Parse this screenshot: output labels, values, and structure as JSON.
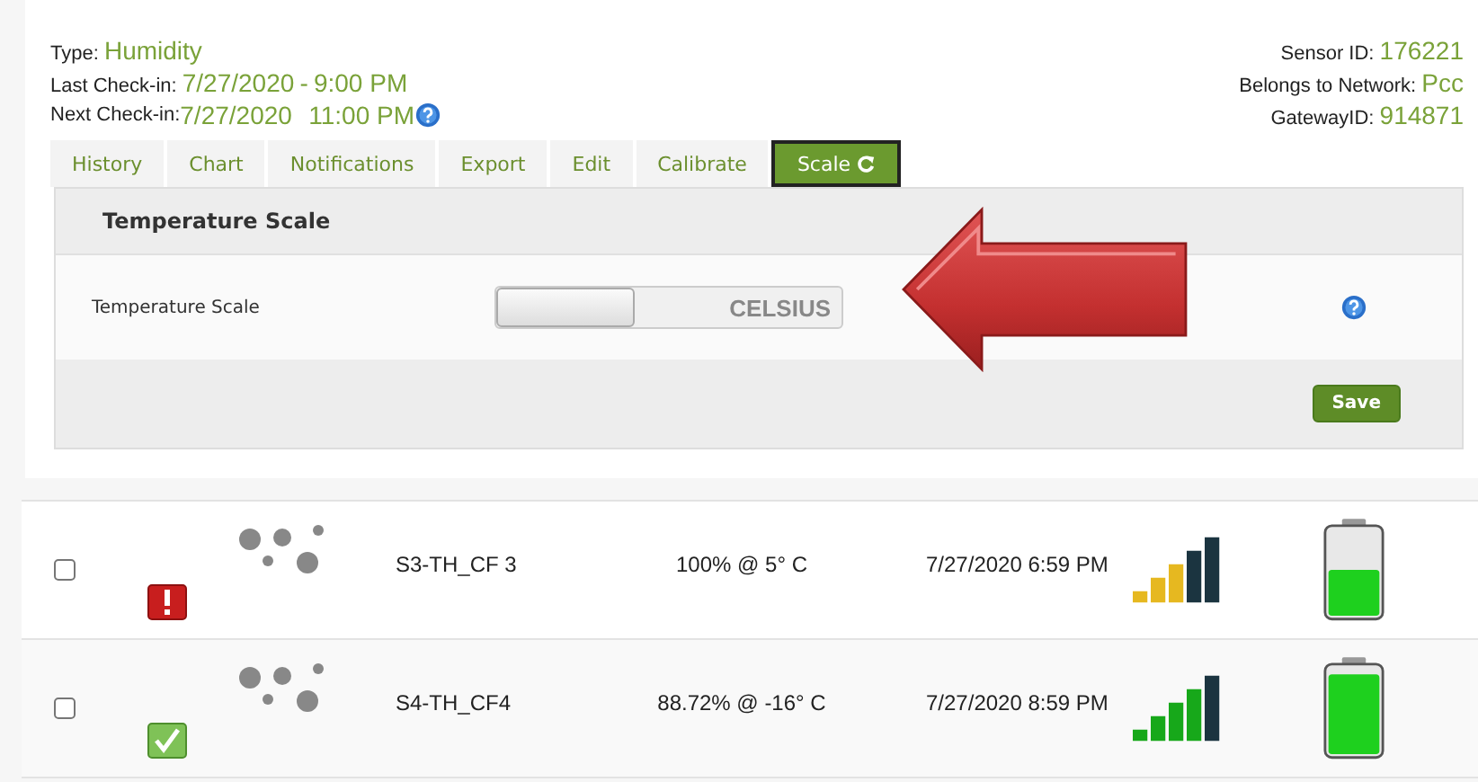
{
  "sensor": {
    "type_label": "Type:",
    "type": "Humidity",
    "last_label": "Last Check-in:",
    "last_date": "7/27/2020",
    "last_sep": "-",
    "last_time": "9:00 PM",
    "next_label": "Next Check-in:",
    "next_date": "7/27/2020",
    "next_time": "11:00 PM",
    "id_label": "Sensor ID:",
    "id": "176221",
    "network_label": "Belongs to Network:",
    "network": "Pcc",
    "gateway_label": "GatewayID:",
    "gateway": "914871"
  },
  "tabs": [
    {
      "label": "History",
      "selected": false
    },
    {
      "label": "Chart",
      "selected": false
    },
    {
      "label": "Notifications",
      "selected": false
    },
    {
      "label": "Export",
      "selected": false
    },
    {
      "label": "Edit",
      "selected": false
    },
    {
      "label": "Calibrate",
      "selected": false
    },
    {
      "label": "Scale",
      "selected": true
    }
  ],
  "panel": {
    "title": "Temperature Scale",
    "field_label": "Temperature Scale",
    "toggle_value": "CELSIUS",
    "save": "Save"
  },
  "rows": [
    {
      "checked": false,
      "kind": "alert",
      "name": "S3-TH_CF 3",
      "reading": "100% @ 5° C",
      "date": "7/27/2020 6:59 PM"
    },
    {
      "checked": false,
      "kind": "ok",
      "name": "S4-TH_CF4",
      "reading": "88.72% @ -16° C",
      "date": "7/27/2020 8:59 PM"
    }
  ]
}
